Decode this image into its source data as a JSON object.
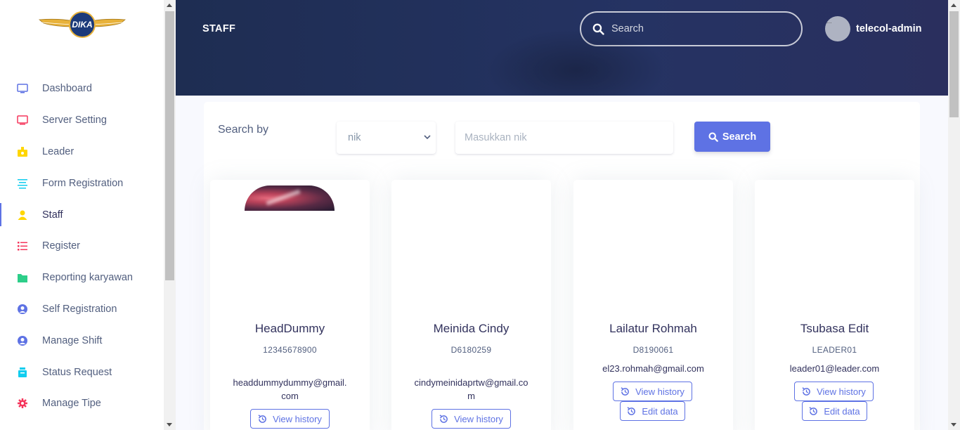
{
  "brand": {
    "logo_text": "DIKA"
  },
  "sidebar": {
    "items": [
      {
        "label": "Dashboard",
        "icon": "monitor-icon",
        "color": "#5e72e4"
      },
      {
        "label": "Server Setting",
        "icon": "tv-icon",
        "color": "#f5365c"
      },
      {
        "label": "Leader",
        "icon": "badge-icon",
        "color": "#ffd600"
      },
      {
        "label": "Form Registration",
        "icon": "align-icon",
        "color": "#11cdef"
      },
      {
        "label": "Staff",
        "icon": "user-icon",
        "color": "#ffd600",
        "active": true
      },
      {
        "label": "Register",
        "icon": "list-icon",
        "color": "#f5365c"
      },
      {
        "label": "Reporting karyawan",
        "icon": "folder-icon",
        "color": "#2dce89"
      },
      {
        "label": "Self Registration",
        "icon": "user-circle-icon",
        "color": "#5e72e4"
      },
      {
        "label": "Manage Shift",
        "icon": "user-circle-icon",
        "color": "#5e72e4"
      },
      {
        "label": "Status Request",
        "icon": "box-icon",
        "color": "#11cdef"
      },
      {
        "label": "Manage Tipe",
        "icon": "gear-icon",
        "color": "#f5365c"
      }
    ]
  },
  "header": {
    "title": "STAFF",
    "search_placeholder": "Search",
    "user_name": "telecol-admin",
    "avatar_alt": "..."
  },
  "filter": {
    "label": "Search by",
    "selected": "nik",
    "placeholder": "Masukkan nik",
    "button": "Search"
  },
  "staff": [
    {
      "name": "HeadDummy",
      "nik": "12345678900",
      "email_line1": "headdummydummy@gmail.",
      "email_line2": "com",
      "has_photo": true,
      "actions": [
        "View history"
      ]
    },
    {
      "name": "Meinida Cindy",
      "nik": "D6180259",
      "email_line1": "cindymeinidaprtw@gmail.co",
      "email_line2": "m",
      "has_photo": false,
      "actions": [
        "View history"
      ]
    },
    {
      "name": "Lailatur Rohmah",
      "nik": "D8190061",
      "email_line1": "el23.rohmah@gmail.com",
      "email_line2": "",
      "has_photo": false,
      "actions": [
        "View history",
        "Edit data"
      ]
    },
    {
      "name": "Tsubasa Edit",
      "nik": "LEADER01",
      "email_line1": "leader01@leader.com",
      "email_line2": "",
      "has_photo": false,
      "actions": [
        "View history",
        "Edit data"
      ]
    }
  ]
}
